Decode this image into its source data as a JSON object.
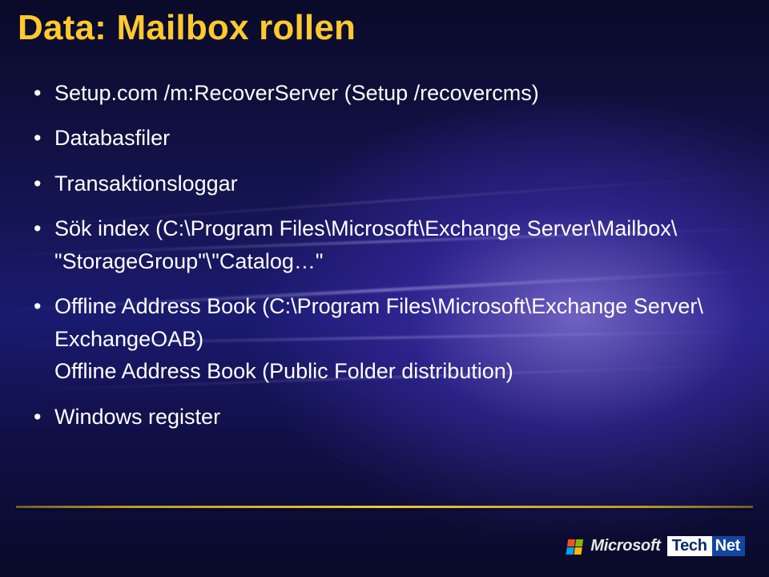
{
  "title": "Data: Mailbox rollen",
  "bullets": {
    "b1": "Setup.com /m:RecoverServer (Setup /recovercms)",
    "b2": "Databasfiler",
    "b3": "Transaktionsloggar",
    "b4_l1": "Sök index (C:\\Program Files\\Microsoft\\Exchange Server\\Mailbox\\",
    "b4_l2": "\"StorageGroup\"\\\"Catalog…\"",
    "b5_l1": "Offline Address Book (C:\\Program Files\\Microsoft\\Exchange Server\\",
    "b5_l2": "ExchangeOAB)",
    "b5_l3": "Offline Address Book (Public Folder distribution)",
    "b6": "Windows register"
  },
  "footer": {
    "microsoft": "Microsoft",
    "tech": "Tech",
    "net": "Net"
  }
}
